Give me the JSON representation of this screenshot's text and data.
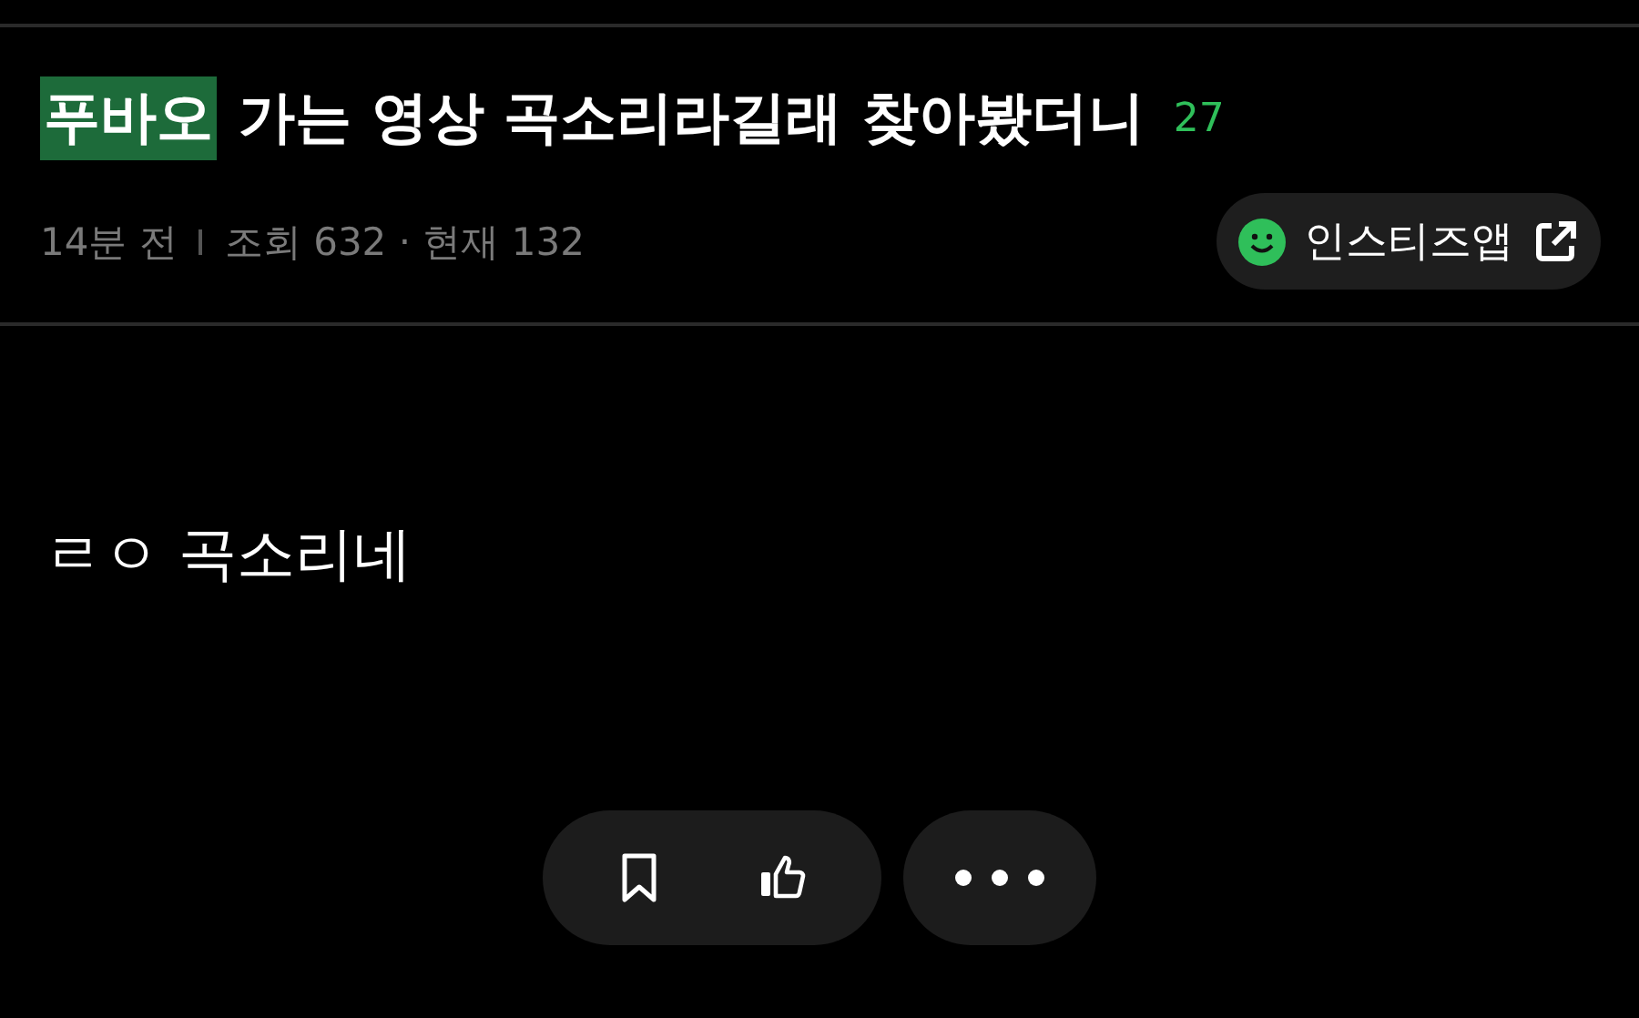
{
  "post": {
    "tag": "푸바오",
    "title": "가는 영상 곡소리라길래 찾아봤더니",
    "comment_count": "27",
    "time": "14분 전",
    "stats": "조회 632 · 현재 132",
    "app_button": "인스티즈앱",
    "body": "ㄹㅇ 곡소리네"
  },
  "actions": [
    {
      "kind": "bookmark"
    },
    {
      "kind": "like"
    },
    {
      "kind": "more"
    }
  ]
}
